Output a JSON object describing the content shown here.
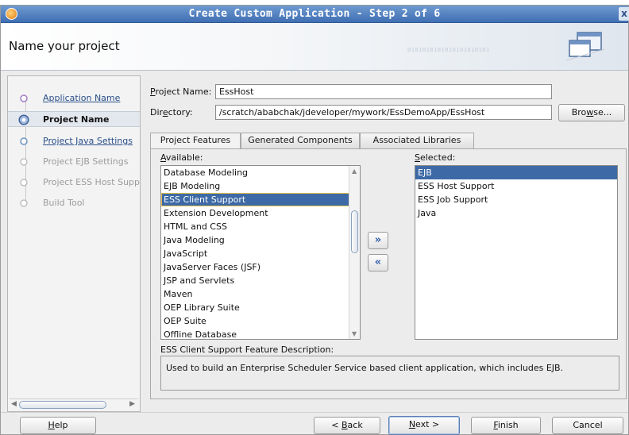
{
  "window": {
    "title": "Create Custom Application - Step 2 of 6",
    "close_glyph": "x"
  },
  "header": {
    "heading": "Name your project",
    "binary_decoration": "0101010101010101010101"
  },
  "nav": {
    "items": [
      {
        "label": "Application Name",
        "state": "link"
      },
      {
        "label": "Project Name",
        "state": "current"
      },
      {
        "label": "Project Java Settings",
        "state": "link"
      },
      {
        "label": "Project EJB Settings",
        "state": "disabled"
      },
      {
        "label": "Project ESS Host Supp",
        "state": "disabled"
      },
      {
        "label": "Build Tool",
        "state": "disabled"
      }
    ]
  },
  "form": {
    "project_name_label_prefix": "P",
    "project_name_label_rest": "roject Name:",
    "project_name_value": "EssHost",
    "directory_label_prefix": "Dir",
    "directory_label_mnemonic": "e",
    "directory_label_rest": "ctory:",
    "directory_value": "/scratch/ababchak/jdeveloper/mywork/EssDemoApp/EssHost",
    "browse_prefix": "Bro",
    "browse_mnemonic": "w",
    "browse_rest": "se..."
  },
  "tabs": [
    {
      "label": "Project Features",
      "active": true
    },
    {
      "label": "Generated Components",
      "active": false
    },
    {
      "label": "Associated Libraries",
      "active": false
    }
  ],
  "features": {
    "available_label_mnemonic": "A",
    "available_label_rest": "vailable:",
    "available": [
      "Database Modeling",
      "EJB Modeling",
      "ESS Client Support",
      "Extension Development",
      "HTML and CSS",
      "Java Modeling",
      "JavaScript",
      "JavaServer Faces (JSF)",
      "JSP and Servlets",
      "Maven",
      "OEP Library Suite",
      "OEP Suite",
      "Offline Database"
    ],
    "available_selected_index": 2,
    "selected_label_mnemonic": "S",
    "selected_label_rest": "elected:",
    "selected": [
      "EJB",
      "ESS Host Support",
      "ESS Job Support",
      "Java"
    ],
    "selected_selected_index": 0,
    "add_glyph": "»",
    "remove_glyph": "«",
    "description_title": "ESS Client Support Feature Description:",
    "description_text": "Used to build an Enterprise Scheduler Service based client application, which includes EJB."
  },
  "footer": {
    "help_mnemonic": "H",
    "help_rest": "elp",
    "back_prefix": "< ",
    "back_mnemonic": "B",
    "back_rest": "ack",
    "next_mnemonic": "N",
    "next_rest": "ext >",
    "finish_mnemonic": "F",
    "finish_rest": "inish",
    "cancel_label": "Cancel"
  }
}
